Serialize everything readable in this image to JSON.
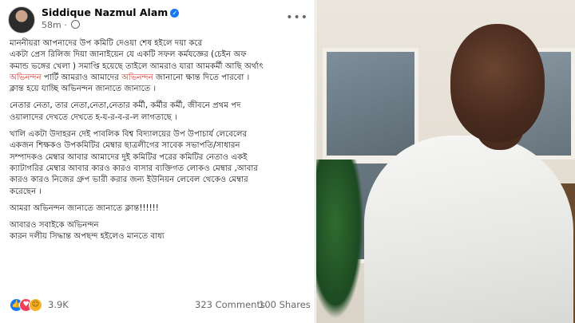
{
  "post": {
    "author": "Siddique Nazmul Alam",
    "time": "58m",
    "more_label": "•••",
    "paragraphs": [
      {
        "lines": [
          [
            {
              "t": "মাননীয়রা আপনাদের উপ কমিটি দেওয়া শেষ হইলে দয়া করে"
            }
          ],
          [
            {
              "t": "একটা প্রেস রিলিজ দিয়া জানাইয়েন যে একটি সফল কর্মযজ্ঞের (চেইন অফ"
            }
          ],
          [
            {
              "t": "কমান্ড ভঙ্গের খেলা ) সমাপ্তি হয়েছে তাইলে আমরাও যারা আমকর্মী আছি অর্থাৎ"
            }
          ],
          [
            {
              "t": "অভিনন্দন",
              "hl": true
            },
            {
              "t": " পার্টি আমরাও আমাদের "
            },
            {
              "t": "অভিনন্দন",
              "hl": true
            },
            {
              "t": " জানানো ক্ষান্ত দিতে পারবো ।"
            }
          ],
          [
            {
              "t": "ক্লান্ত হয়ে যাচ্ছি অভিনন্দন জানাতে জানাতে ।"
            }
          ]
        ]
      },
      {
        "lines": [
          [
            {
              "t": "নেতার নেতা, তার নেতা,নেতা,নেতার কর্মী, কর্মীর কর্মী, জীবনে প্রথম পদ"
            }
          ],
          [
            {
              "t": "ওয়ালাদের দেখতে দেখতে হ-য-র-ব-র-ল লাগতাছে ।"
            }
          ]
        ]
      },
      {
        "lines": [
          [
            {
              "t": "খালি একটা উদাহরন দেই পাবলিক বিশ্ব বিদ্যালয়ের উপ উপাচার্য লেবেলের"
            }
          ],
          [
            {
              "t": "একজন শিক্ষকও উপকমিটির মেম্বার ছাত্রলীগের সাবেক সভাপতি/সাধারন"
            }
          ],
          [
            {
              "t": "সম্পাদকও মেম্বার আবার আমাদের দুই কমিটির পরের কমিটির নেতাও একই"
            }
          ],
          [
            {
              "t": "ক্যাটাগরির মেম্বার আবার কারও কারও বাসার ব্যক্তিগত লোকও মেম্বার ,আবার"
            }
          ],
          [
            {
              "t": "কারও কারও নিজের গ্রুপ ভারী করার জন্য ইউনিয়ন লেবেল থেকেও মেম্বার"
            }
          ],
          [
            {
              "t": "করেছেন ।"
            }
          ]
        ]
      },
      {
        "lines": [
          [
            {
              "t": "আমরা অভিনন্দন জানাতে জানাতে ক্লান্ত!!!!!!"
            }
          ]
        ]
      },
      {
        "lines": [
          [
            {
              "t": "আবারও সবাইকে অভিনন্দন"
            }
          ],
          [
            {
              "t": "কারন দলীয় সিদ্ধান্ত অপছন্দ হইলেও মানতে বাধ্য"
            }
          ]
        ]
      }
    ],
    "reaction_count": "3.9K",
    "comments": "323 Comments",
    "shares": "100 Shares",
    "reaction_icons": [
      "like-icon",
      "love-icon",
      "haha-icon"
    ]
  },
  "colors": {
    "highlight": "#d0302b",
    "link_blue": "#1877f2",
    "meta_gray": "#65676b"
  }
}
